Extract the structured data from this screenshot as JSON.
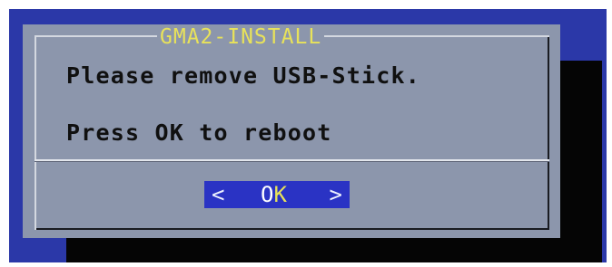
{
  "dialog": {
    "title": "GMA2-INSTALL",
    "message_line_1": "Please remove USB-Stick.",
    "message_line_2": "Press OK to reboot",
    "ok_button": {
      "left_bracket": "<",
      "label": "O",
      "hotkey_letter": "K",
      "right_bracket": ">"
    }
  },
  "colors": {
    "screen_background": "#2b38a8",
    "dialog_background": "#8c96ac",
    "title_text": "#e8e25a",
    "button_background": "#2a33c4",
    "shadow": "#050505"
  }
}
